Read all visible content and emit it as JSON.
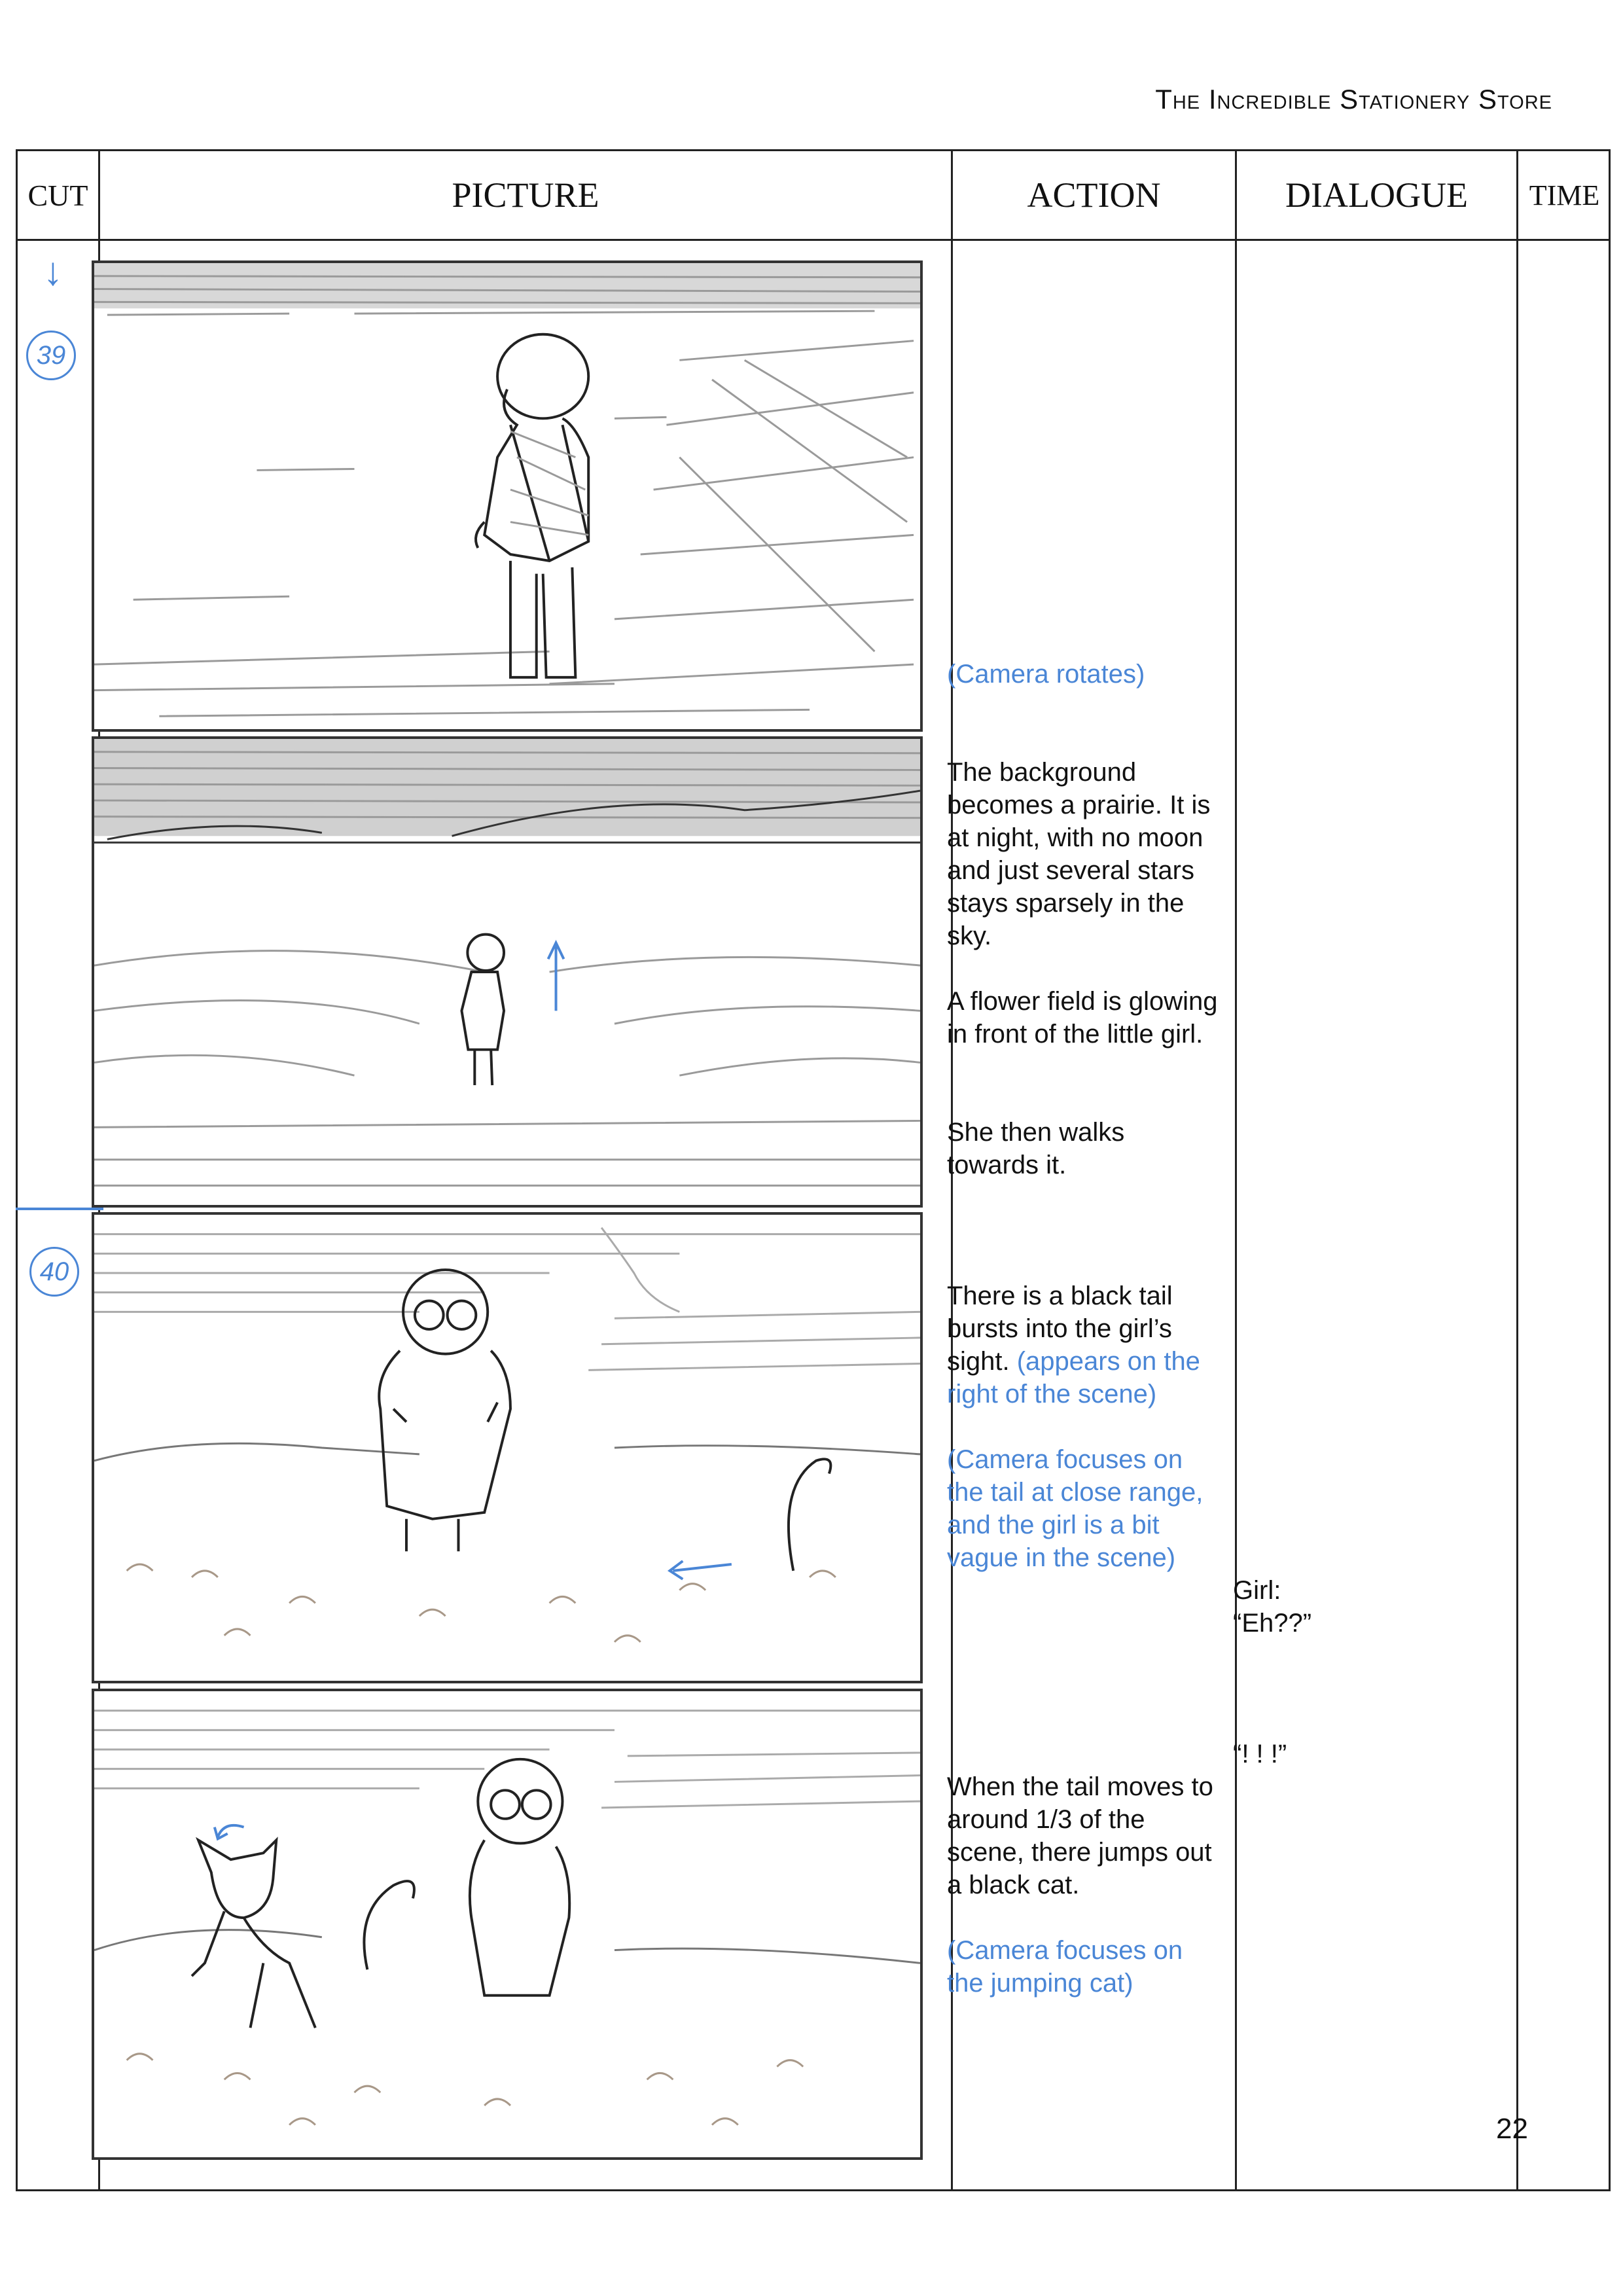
{
  "header": {
    "title": "The Incredible Stationery Store"
  },
  "table": {
    "columns": {
      "cut": "CUT",
      "picture": "PICTURE",
      "action": "ACTION",
      "dialogue": "DIALOGUE",
      "time": "TIME"
    }
  },
  "cuts": [
    {
      "number": "39"
    },
    {
      "number": "40"
    }
  ],
  "actions": {
    "a1": "(Camera rotates)",
    "a2": "The background becomes a prairie. It is at night, with no moon and just several stars stays sparsely in the sky.",
    "a3": "A flower field is glowing in front of the little girl.",
    "a4": "She then walks towards it.",
    "a5_main": "There is a black tail bursts into the girl’s sight.",
    "a5_blue": "(appears on the right of the scene)",
    "a6": "(Camera focuses on the tail at close range, and the girl is a bit vague in the scene)",
    "a7": "When the tail moves to around 1/3 of the scene, there jumps out a black cat.",
    "a8": "(Camera focuses on the jumping cat)"
  },
  "dialogue": {
    "d1_speaker": "Girl:",
    "d1_line": "“Eh??”",
    "d2_line": "“! ! !”"
  },
  "footer": {
    "page": "22"
  },
  "colors": {
    "annotation_blue": "#4a86d6",
    "pencil_gray": "#9a9a9a",
    "ink": "#222222"
  }
}
